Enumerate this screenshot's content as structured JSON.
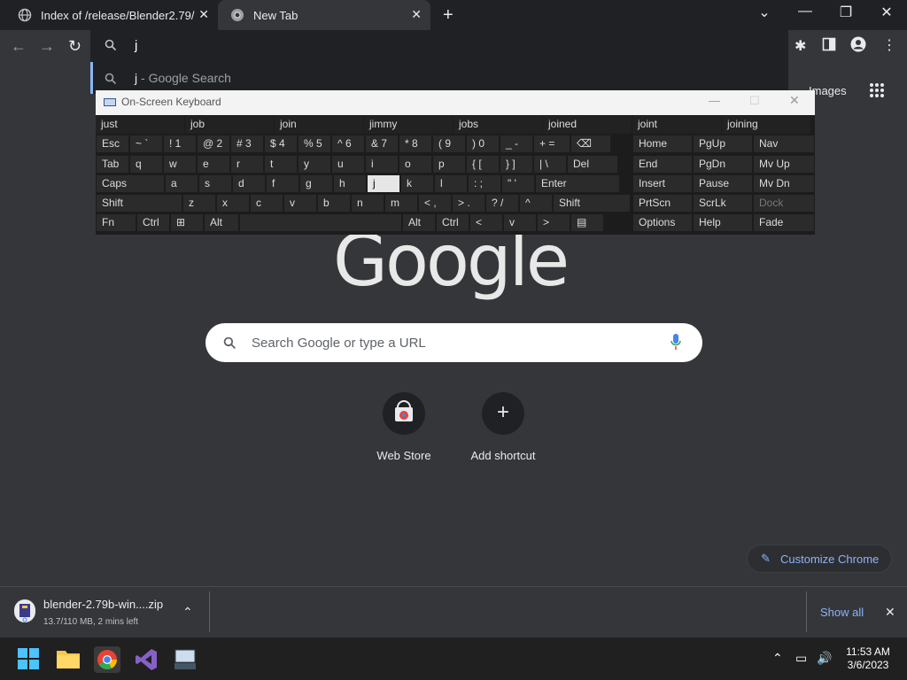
{
  "browser": {
    "tabs": [
      {
        "title": "Index of /release/Blender2.79/"
      },
      {
        "title": "New Tab"
      }
    ],
    "omnibox_value": "j",
    "suggestion": {
      "query": "j",
      "suffix": " - Google Search"
    },
    "images_link": "Images"
  },
  "osk": {
    "title": "On-Screen Keyboard",
    "predictions": [
      "just",
      "job",
      "join",
      "jimmy",
      "jobs",
      "joined",
      "joint",
      "joining"
    ],
    "rows": [
      [
        "Esc",
        "~ `",
        "! 1",
        "@ 2",
        "# 3",
        "$ 4",
        "% 5",
        "^ 6",
        "& 7",
        "* 8",
        "( 9",
        ") 0",
        "_ -",
        "+ =",
        "⌫"
      ],
      [
        "Tab",
        "q",
        "w",
        "e",
        "r",
        "t",
        "y",
        "u",
        "i",
        "o",
        "p",
        "{ [",
        "} ]",
        "| \\",
        "Del"
      ],
      [
        "Caps",
        "a",
        "s",
        "d",
        "f",
        "g",
        "h",
        "j",
        "k",
        "l",
        ": ;",
        "\" '",
        "Enter"
      ],
      [
        "Shift",
        "z",
        "x",
        "c",
        "v",
        "b",
        "n",
        "m",
        "< ,",
        "> .",
        "? /",
        "^",
        "Shift"
      ],
      [
        "Fn",
        "Ctrl",
        "⊞",
        "Alt",
        "",
        "Alt",
        "Ctrl",
        "<",
        "v",
        ">",
        "▤"
      ]
    ],
    "side_keys": [
      [
        "Home",
        "PgUp",
        "Nav"
      ],
      [
        "End",
        "PgDn",
        "Mv Up"
      ],
      [
        "Insert",
        "Pause",
        "Mv Dn"
      ],
      [
        "PrtScn",
        "ScrLk",
        "Dock"
      ],
      [
        "Options",
        "Help",
        "Fade"
      ]
    ]
  },
  "page": {
    "logo_text": "Google",
    "search_placeholder": "Search Google or type a URL",
    "shortcuts": [
      {
        "label": "Web Store"
      },
      {
        "label": "Add shortcut"
      }
    ],
    "customize_label": "Customize Chrome"
  },
  "downloads": {
    "file_name": "blender-2.79b-win....zip",
    "status": "13.7/110 MB, 2 mins left",
    "show_all": "Show all"
  },
  "taskbar": {
    "time": "11:53 AM",
    "date": "3/6/2023"
  },
  "colors": {
    "accent": "#8ab4f8",
    "page_bg": "#35363a",
    "tabstrip_bg": "#202124"
  }
}
